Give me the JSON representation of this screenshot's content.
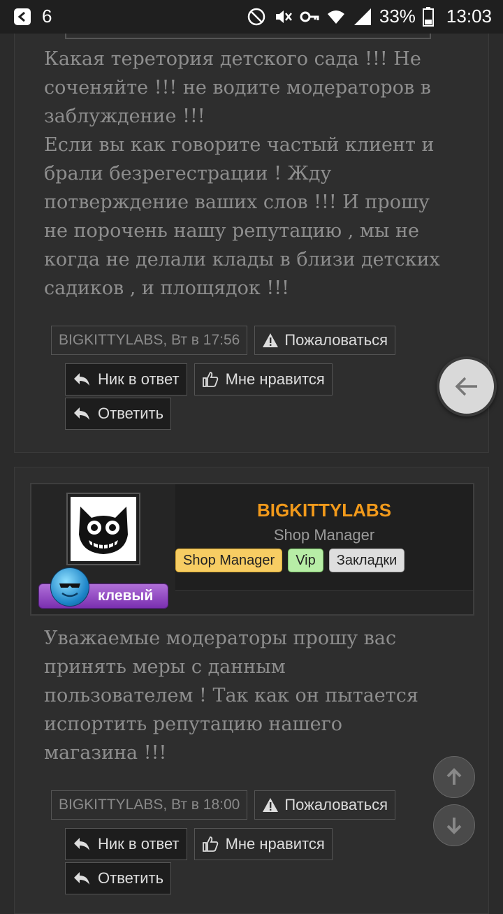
{
  "status_bar": {
    "notification_count": "6",
    "battery": "33%",
    "time": "13:03"
  },
  "post1": {
    "text": "Какая теретория детского сада !!! Не\nсоченяйте !!! не водите модераторов в\nзаблуждение !!!\nЕсли вы как говорите частый клиент и\nбрали безрегестрации ! Жду\nпотверждение ваших слов !!! И прошу\nне порочень нашу репутацию , мы не\nкогда не делали клады в близи детских\nсадиков , и площядок !!!",
    "meta": "BIGKITTYLABS, Вт в 17:56",
    "report_label": "Пожаловаться",
    "nick_reply_label": "Ник в ответ",
    "like_label": "Мне нравится",
    "reply_label": "Ответить"
  },
  "post2": {
    "username": "BIGKITTYLABS",
    "user_title": "Shop Manager",
    "tags": [
      "Shop Manager",
      "Vip",
      "Закладки"
    ],
    "rank_label": "клевый",
    "text": "Уважаемые модераторы прошу вас\nпринять меры с данным\nпользователем ! Так как он пытается\nиспортить репутацию нашего\nмагазина !!!",
    "meta": "BIGKITTYLABS, Вт в 18:00",
    "report_label": "Пожаловаться",
    "nick_reply_label": "Ник в ответ",
    "like_label": "Мне нравится",
    "reply_label": "Ответить"
  },
  "icons": {
    "back": "arrow-left-icon",
    "scroll_up": "arrow-up-icon",
    "scroll_down": "arrow-down-icon",
    "report": "warning-icon",
    "reply": "reply-icon",
    "like": "thumbs-up-icon"
  },
  "colors": {
    "username": "#f29a1b",
    "background": "#2b2b2b",
    "text": "#8e8e8e"
  }
}
